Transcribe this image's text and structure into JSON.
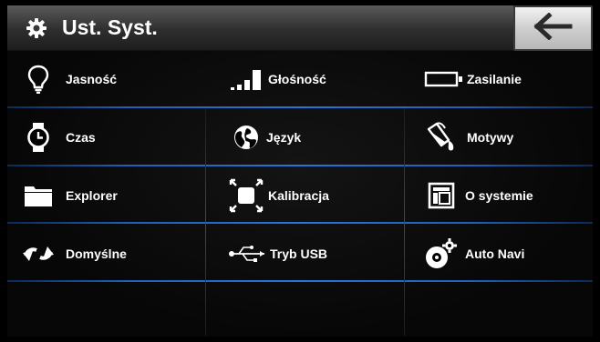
{
  "header": {
    "title": "Ust. Syst.",
    "icon": "gear-icon",
    "back_icon": "arrow-left-icon"
  },
  "menu": [
    {
      "label": "Jasność",
      "icon": "lightbulb-icon"
    },
    {
      "label": "Głośność",
      "icon": "volume-bars-icon"
    },
    {
      "label": "Zasilanie",
      "icon": "battery-icon"
    },
    {
      "label": "Czas",
      "icon": "watch-icon"
    },
    {
      "label": "Język",
      "icon": "globe-icon"
    },
    {
      "label": "Motywy",
      "icon": "paint-bucket-icon"
    },
    {
      "label": "Explorer",
      "icon": "folder-icon"
    },
    {
      "label": "Kalibracja",
      "icon": "calibration-icon"
    },
    {
      "label": "O systemie",
      "icon": "system-window-icon"
    },
    {
      "label": "Domyślne",
      "icon": "reset-arrows-icon"
    },
    {
      "label": "Tryb USB",
      "icon": "usb-icon"
    },
    {
      "label": "Auto Navi",
      "icon": "disc-gear-icon"
    }
  ],
  "colors": {
    "grid_line": "#2a74d6",
    "background": "#000000",
    "back_button": "#d9d9d9"
  }
}
